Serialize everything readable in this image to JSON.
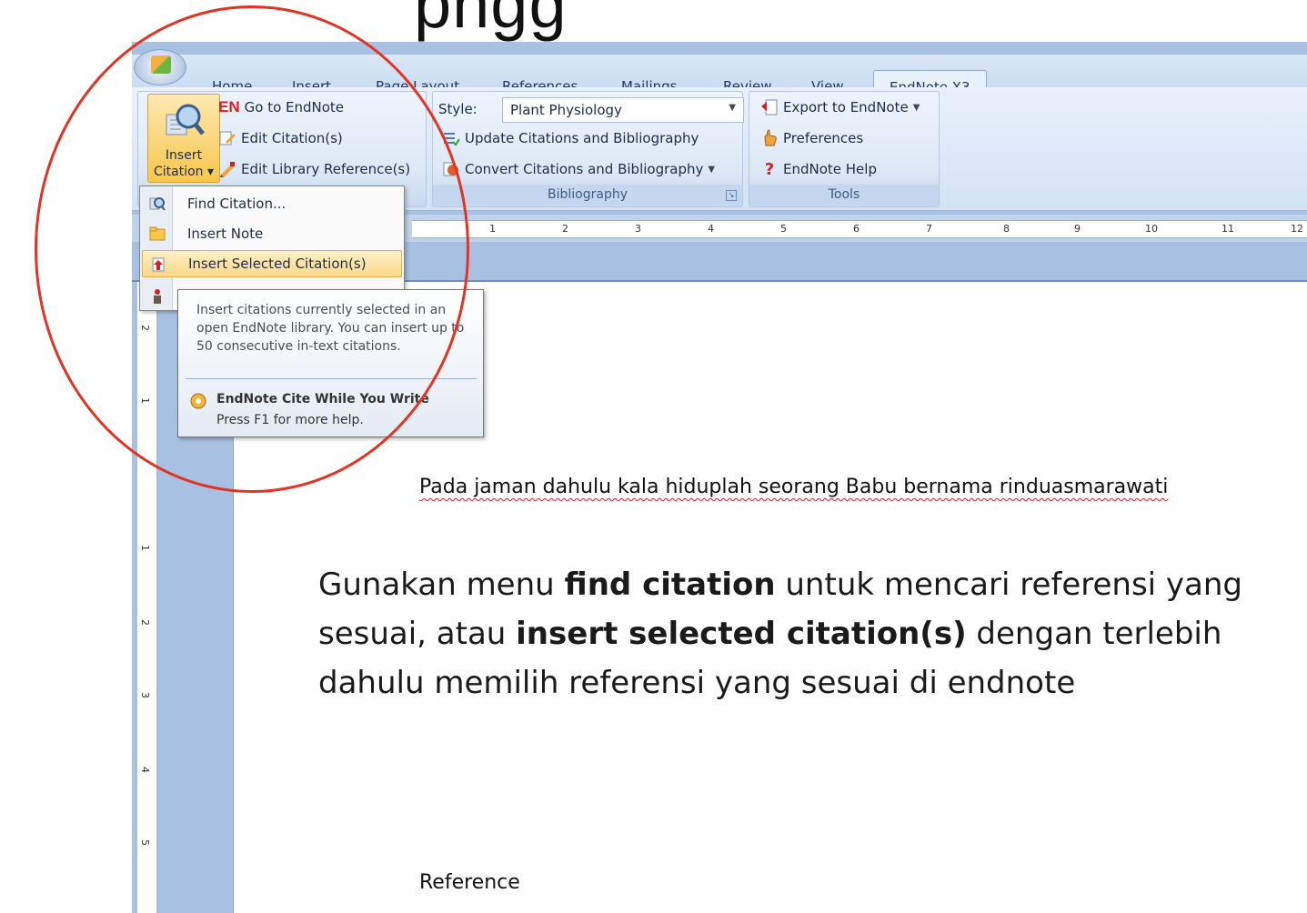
{
  "slide": {
    "title_fragment": "pngg"
  },
  "ribbon_tabs": [
    "Home",
    "Insert",
    "Page Layout",
    "References",
    "Mailings",
    "Review",
    "View",
    "EndNote X3"
  ],
  "citations_group": {
    "insert_citation_label_line1": "Insert",
    "insert_citation_label_line2": "Citation",
    "go_to_endnote_en": "EN",
    "go_to_endnote": "Go to EndNote",
    "edit_citations": "Edit Citation(s)",
    "edit_library_reference": "Edit Library Reference(s)"
  },
  "bibliography_group": {
    "style_label": "Style:",
    "style_value": "Plant Physiology",
    "update": "Update Citations and Bibliography",
    "convert": "Convert Citations and Bibliography",
    "label": "Bibliography"
  },
  "tools_group": {
    "export": "Export to EndNote",
    "preferences": "Preferences",
    "help": "EndNote Help",
    "label": "Tools"
  },
  "menu": {
    "find_citation": "Find Citation...",
    "insert_note": "Insert Note",
    "insert_selected": "Insert Selected Citation(s)"
  },
  "tooltip": {
    "body": "Insert citations currently selected in an open EndNote library. You can insert up to 50 consecutive in-text citations.",
    "footer_title": "EndNote Cite While You Write",
    "footer_help": "Press F1 for more help."
  },
  "ruler_numbers": [
    "1",
    "2",
    "3",
    "4",
    "5",
    "6",
    "7",
    "8",
    "9",
    "10",
    "11",
    "12"
  ],
  "vruler_numbers": [
    "2",
    "1",
    "1",
    "2",
    "3",
    "4",
    "5"
  ],
  "document": {
    "line1": "Pada jaman dahulu kala hiduplah seorang Babu bernama rinduasmarawati",
    "reference_heading": "Reference"
  },
  "callout": {
    "p1": "Gunakan menu ",
    "b1": "find citation",
    "p2": " untuk mencari referensi yang sesuai, atau ",
    "b2": "insert selected citation(s)",
    "p3": " dengan terlebih dahulu memilih referensi yang sesuai di endnote"
  },
  "colors": {
    "ribbon_bg": "#dbe7f6",
    "highlight": "#fbd988",
    "annotation_circle": "#e03425"
  }
}
